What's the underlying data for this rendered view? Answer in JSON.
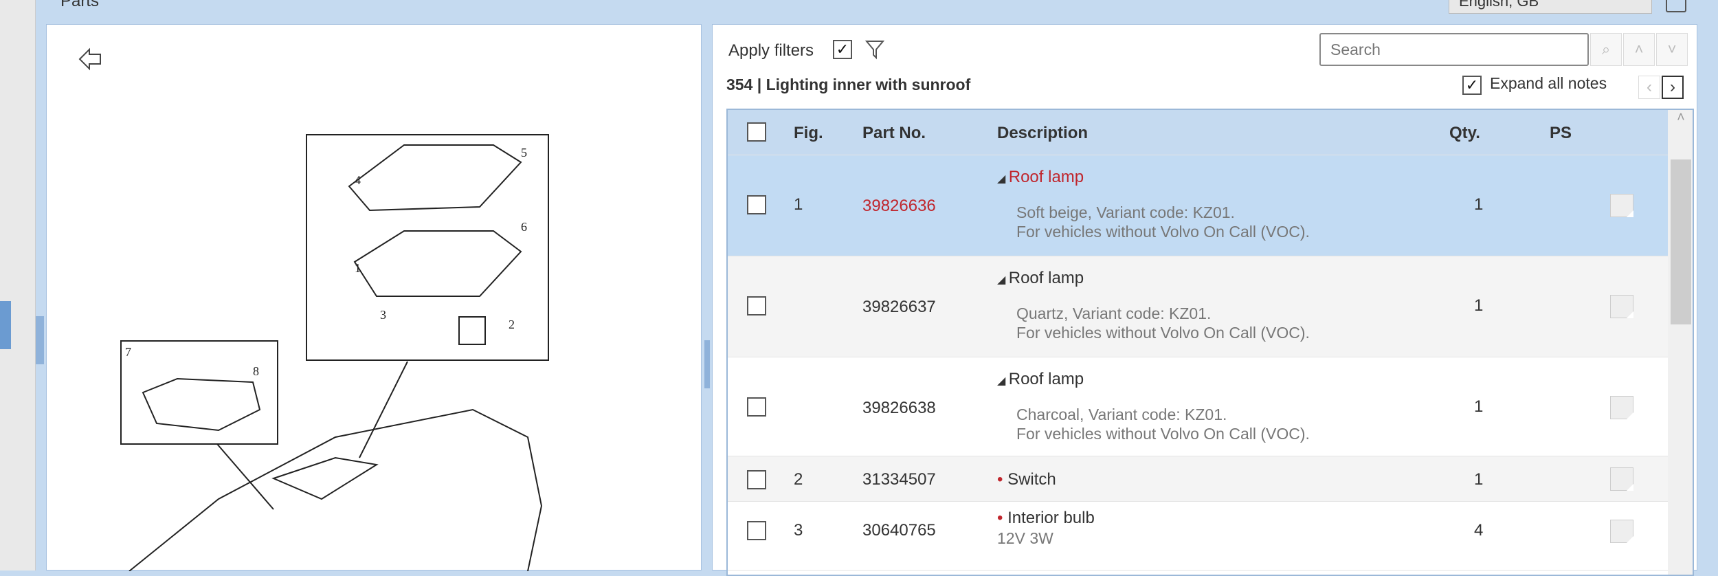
{
  "header": {
    "title": "Parts",
    "language": "English, GB"
  },
  "toolbar": {
    "apply_filters_label": "Apply filters",
    "apply_filters_checked": true,
    "search_placeholder": "Search",
    "expand_all_notes_label": "Expand all notes",
    "expand_all_notes_checked": true
  },
  "section": {
    "number": "354",
    "separator": "|",
    "title": "Lighting inner with sunroof"
  },
  "table": {
    "headers": {
      "fig": "Fig.",
      "part_no": "Part No.",
      "description": "Description",
      "qty": "Qty.",
      "ps": "PS"
    },
    "rows": [
      {
        "fig": "1",
        "part_no": "39826636",
        "title": "Roof lamp",
        "note1": "Soft beige, Variant code: KZ01.",
        "note2": "For vehicles without Volvo On Call (VOC).",
        "qty": "1",
        "selected": true
      },
      {
        "fig": "",
        "part_no": "39826637",
        "title": "Roof lamp",
        "note1": "Quartz, Variant code: KZ01.",
        "note2": "For vehicles without Volvo On Call (VOC).",
        "qty": "1"
      },
      {
        "fig": "",
        "part_no": "39826638",
        "title": "Roof lamp",
        "note1": "Charcoal, Variant code: KZ01.",
        "note2": "For vehicles without Volvo On Call (VOC).",
        "qty": "1"
      },
      {
        "fig": "2",
        "part_no": "31334507",
        "title": "Switch",
        "qty": "1"
      },
      {
        "fig": "3",
        "part_no": "30640765",
        "title": "Interior bulb",
        "note1": "12V 3W",
        "qty": "4"
      }
    ]
  },
  "diagram": {
    "labels": [
      "4",
      "5",
      "6",
      "1",
      "3",
      "2",
      "7",
      "8"
    ]
  },
  "colors": {
    "accent": "#c0262d",
    "header_bg": "#c5daf0",
    "selected_row": "#c2dbf3"
  }
}
